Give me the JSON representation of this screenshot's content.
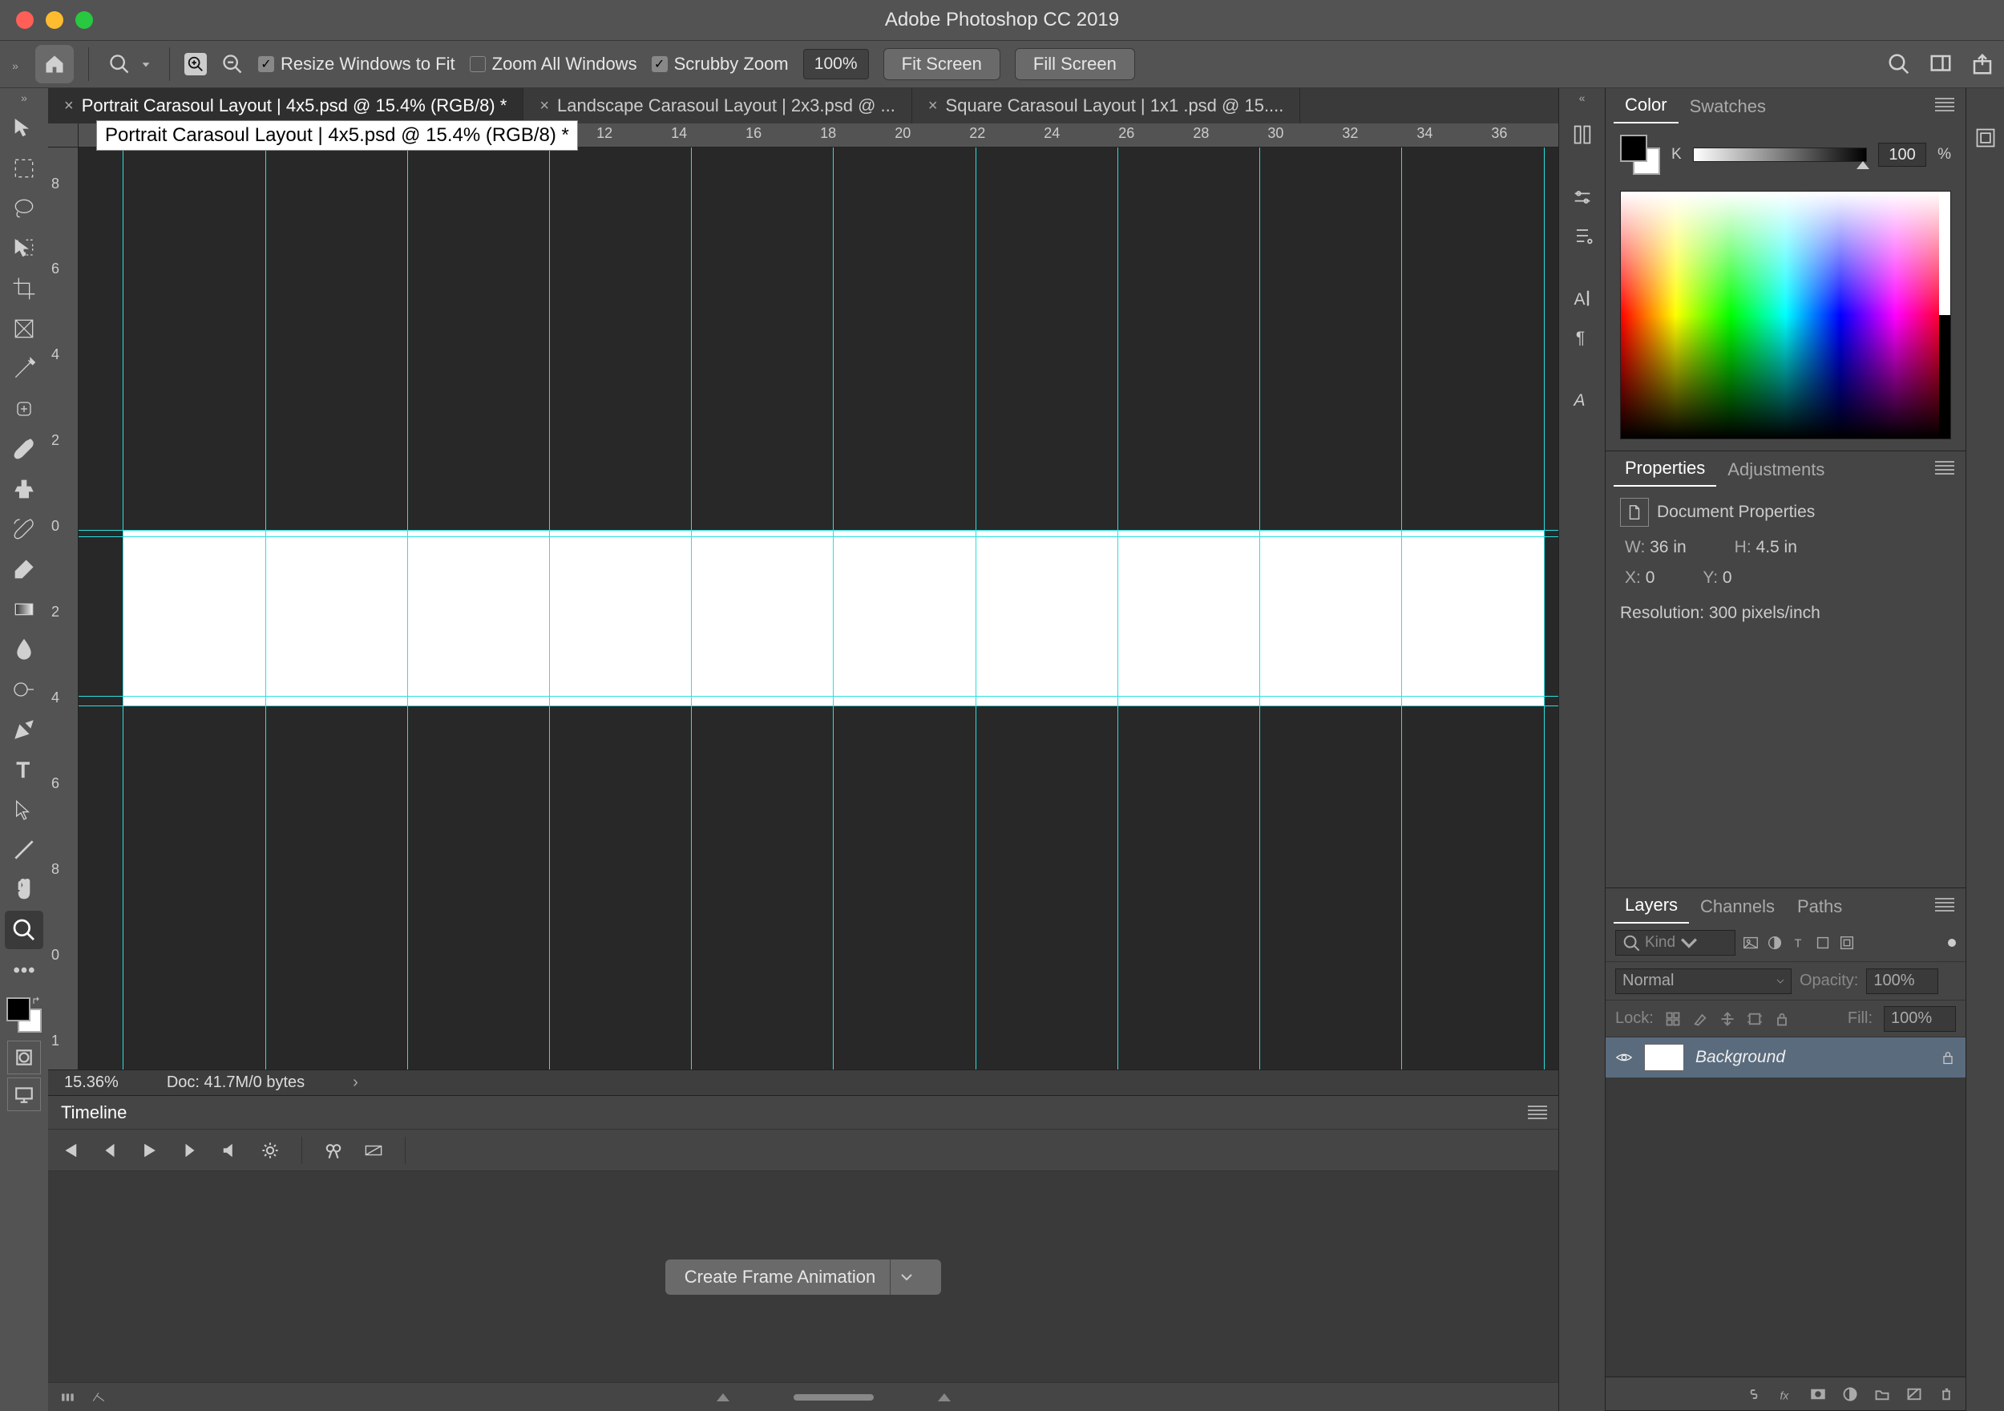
{
  "app_title": "Adobe Photoshop CC 2019",
  "options_bar": {
    "resize_windows_label": "Resize Windows to Fit",
    "resize_windows_checked": true,
    "zoom_all_label": "Zoom All Windows",
    "zoom_all_checked": false,
    "scrubby_label": "Scrubby Zoom",
    "scrubby_checked": true,
    "zoom_value": "100%",
    "fit_screen": "Fit Screen",
    "fill_screen": "Fill Screen"
  },
  "document_tabs": [
    {
      "label": "Portrait Carasoul Layout | 4x5.psd @ 15.4% (RGB/8) *",
      "active": true
    },
    {
      "label": "Landscape Carasoul Layout | 2x3.psd @ ...",
      "active": false
    },
    {
      "label": "Square Carasoul Layout | 1x1 .psd @ 15....",
      "active": false
    }
  ],
  "tooltip_text": "Portrait Carasoul Layout | 4x5.psd @ 15.4% (RGB/8) *",
  "ruler_h": [
    "12",
    "14",
    "16",
    "18",
    "20",
    "22",
    "24",
    "26",
    "28",
    "30",
    "32",
    "34",
    "36"
  ],
  "ruler_v": [
    "8",
    "6",
    "4",
    "2",
    "0",
    "2",
    "4",
    "6",
    "8",
    "0",
    "1"
  ],
  "document": {
    "x_pct": 3.0,
    "y_pct": 41.5,
    "w_pct": 96.0,
    "h_pct": 19.0,
    "vguide_pct": [
      3.0,
      12.6,
      22.2,
      31.8,
      41.4,
      51.0,
      60.6,
      70.2,
      79.8,
      89.4,
      99.0
    ],
    "hguide_pct": [
      41.5,
      42.2,
      59.5,
      60.5
    ]
  },
  "status": {
    "zoom": "15.36%",
    "doc": "Doc: 41.7M/0 bytes"
  },
  "timeline": {
    "title": "Timeline",
    "create_btn": "Create Frame Animation"
  },
  "color_panel": {
    "tabs": [
      "Color",
      "Swatches"
    ],
    "k_label": "K",
    "k_value": "100",
    "pct": "%"
  },
  "properties_panel": {
    "tabs": [
      "Properties",
      "Adjustments"
    ],
    "title": "Document Properties",
    "w_label": "W:",
    "w_value": "36 in",
    "h_label": "H:",
    "h_value": "4.5 in",
    "x_label": "X:",
    "x_value": "0",
    "y_label": "Y:",
    "y_value": "0",
    "res": "Resolution: 300 pixels/inch"
  },
  "layers_panel": {
    "tabs": [
      "Layers",
      "Channels",
      "Paths"
    ],
    "filter_kind": "Kind",
    "blend": "Normal",
    "opacity_label": "Opacity:",
    "opacity_value": "100%",
    "lock_label": "Lock:",
    "fill_label": "Fill:",
    "fill_value": "100%",
    "layer_name": "Background"
  }
}
